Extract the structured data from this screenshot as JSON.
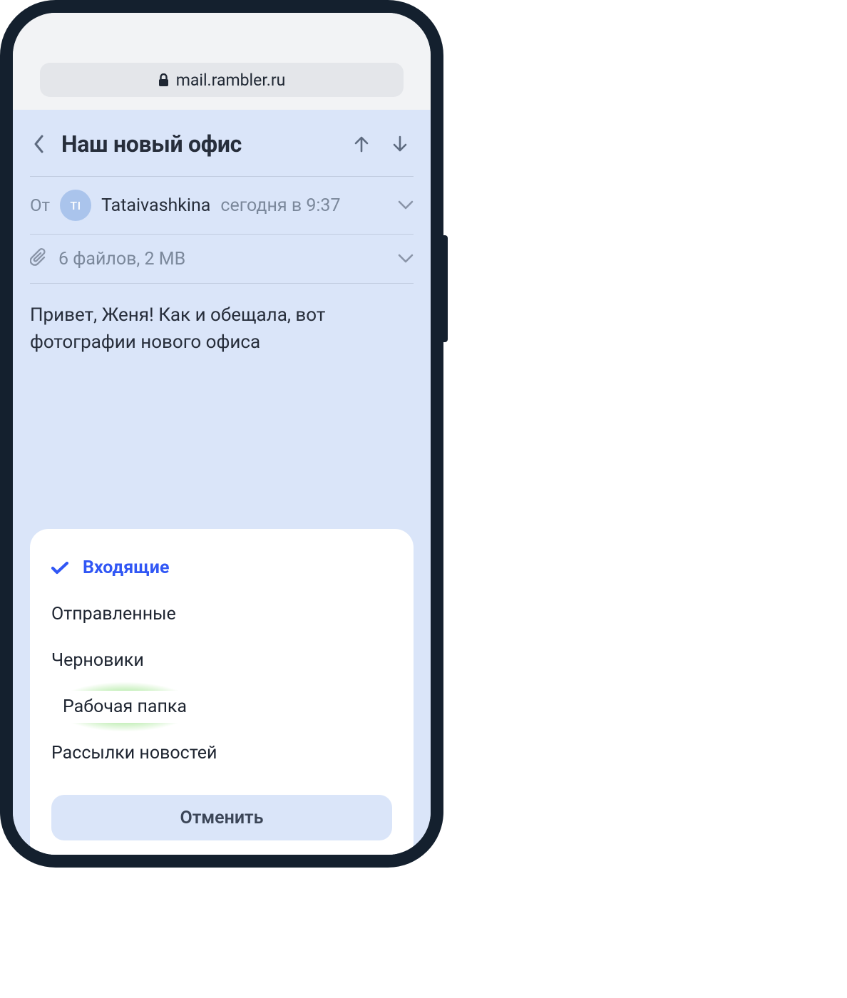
{
  "browser": {
    "url": "mail.rambler.ru"
  },
  "header": {
    "title": "Наш новый офис"
  },
  "sender": {
    "from_label": "От",
    "avatar_initials": "TI",
    "name": "Tataivashkina",
    "time": "сегодня в 9:37"
  },
  "attachments": {
    "summary": "6 файлов, 2 MB"
  },
  "body": {
    "text": "Привет, Женя! Как и обещала, вот фотографии нового офиса"
  },
  "sheet": {
    "folders": [
      {
        "label": "Входящие",
        "selected": true
      },
      {
        "label": "Отправленные",
        "selected": false
      },
      {
        "label": "Черновики",
        "selected": false
      },
      {
        "label": "Рабочая папка",
        "selected": false,
        "highlighted": true
      },
      {
        "label": "Рассылки новостей",
        "selected": false
      }
    ],
    "cancel_label": "Отменить"
  }
}
